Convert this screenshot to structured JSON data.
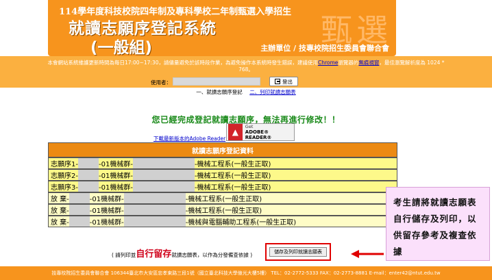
{
  "banner": {
    "subtitle": "114學年度科技校院四年制及專科學校二年制甄選入學招生",
    "title_line1": "就讀志願序登記系統",
    "title_line2": "(一般組)",
    "organizer": "主辦單位 / 技專校院招生委員會聯合會",
    "bg_glyphs": "甄選"
  },
  "notice": {
    "line1_pre": "本會網站系統維護更新時間為每日17:00~17:30，請儘量避免於該時段作業，為避免操作本系統時發生錯誤，建議使用",
    "browser_link": "Chrome",
    "line1_mid": "瀏覽器的",
    "privacy_link": "無痕視窗",
    "line1_post": "，最佳瀏覽解析度為 1024 *",
    "line2": "768。"
  },
  "user": {
    "label": "使用者：",
    "logout": "登出"
  },
  "steps": {
    "step1": "一、就讀志願序登記",
    "step2": "二、列印就讀志願表"
  },
  "message": "您已經完成登記就讀志願序，無法再進行修改！！",
  "reader": {
    "link": "下載最新版本的Adobe Reader",
    "badge_get": "Get",
    "badge_name": "ADOBE® READER®"
  },
  "table": {
    "header": "就讀志願序登記資料",
    "rows": [
      {
        "label": "志願序1-",
        "mid": "-01機械群-",
        "dept": "-機械工程系(一般生正取)"
      },
      {
        "label": "志願序2-",
        "mid": "-01機械群-",
        "dept": "-機械工程系(一般生正取)"
      },
      {
        "label": "志願序3-",
        "mid": "-01機械群-",
        "dept": "-機械工程系(一般生正取)"
      },
      {
        "label": "放 棄-",
        "mid": "-01機械群-",
        "dept": "-機械工程系(一般生正取)"
      },
      {
        "label": "放 棄-",
        "mid": "-01機械群-",
        "dept": "-機械工程系(一般生正取)"
      },
      {
        "label": "放 棄-",
        "mid": "-01機械群-",
        "dept": "-機械與電腦輔助工程系(一般生正取)"
      }
    ]
  },
  "save": {
    "hint_pre": "( 請列印並",
    "hint_emph": "自行留存",
    "hint_post": "就讀志願表，以作為分發備查依據 )",
    "button": "儲存及列印就讀志願表"
  },
  "callout": "考生請將就讀志願表自行儲存及列印，以供留存參考及複查依據",
  "footer": "技專校院招生委員會聯合會 106344臺北市大安區忠孝東路三段1號（國立臺北科技大學億光大樓5樓） TEL：02-2772-5333 FAX：02-2773-8881 E-mail：enter42@ntut.edu.tw",
  "colors": {
    "banner": "#f7941d",
    "notice": "#fbb040",
    "success_text": "#1a8a1a",
    "row_yellow": "#fdf98a",
    "row_cream": "#fefcc6",
    "callout_bg": "#fbe0fb",
    "highlight_red": "#e00000"
  }
}
